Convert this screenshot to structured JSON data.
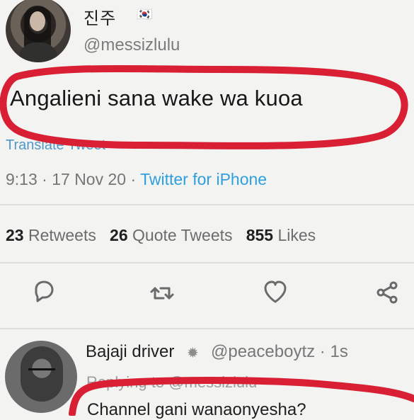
{
  "original_tweet": {
    "display_name": "진주",
    "flag": "🇰🇷",
    "handle": "@messizlulu",
    "text": "Angalieni sana wake wa kuoa",
    "translate_label": "Translate Tweet",
    "time": "9:13",
    "date": "17 Nov 20",
    "client": "Twitter for iPhone"
  },
  "stats": {
    "retweets_count": "23",
    "retweets_label": "Retweets",
    "quote_tweets_count": "26",
    "quote_tweets_label": "Quote Tweets",
    "likes_count": "855",
    "likes_label": "Likes"
  },
  "actions": {
    "reply_icon": "reply-icon",
    "retweet_icon": "retweet-icon",
    "like_icon": "heart-icon",
    "share_icon": "share-icon"
  },
  "reply_tweet": {
    "display_name": "Bajaji driver",
    "handle": "@peaceboytz",
    "time": "1s",
    "replying_to": "Replying to @messizlulu",
    "text": "Channel gani wanaonyesha?"
  },
  "colors": {
    "accent_blue": "#2f9fdf",
    "marker_red": "#d91f33"
  }
}
